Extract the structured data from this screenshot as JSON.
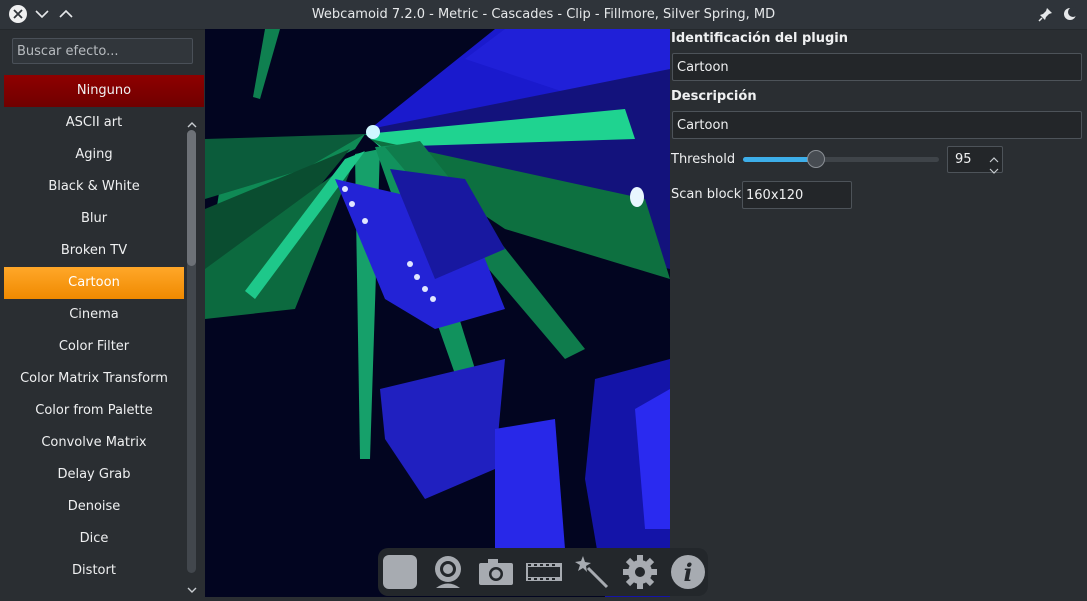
{
  "window": {
    "title": "Webcamoid 7.2.0 - Metric - Cascades - Clip - Fillmore, Silver Spring, MD",
    "close_icon": "close-icon",
    "minimize_icon": "chevron-down-icon",
    "maximize_icon": "chevron-up-icon",
    "pin_icon": "pin-icon",
    "theme_icon": "moon-icon"
  },
  "effects": {
    "search_placeholder": "Buscar efecto...",
    "none_label": "Ninguno",
    "selected": "Cartoon",
    "items": [
      "ASCII art",
      "Aging",
      "Black & White",
      "Blur",
      "Broken TV",
      "Cartoon",
      "Cinema",
      "Color Filter",
      "Color Matrix Transform",
      "Color from Palette",
      "Convolve Matrix",
      "Delay Grab",
      "Denoise",
      "Dice",
      "Distort"
    ]
  },
  "toolbar": {
    "items": [
      "stop-icon",
      "webcam-icon",
      "camera-icon",
      "film-icon",
      "magic-wand-icon",
      "gear-icon",
      "info-icon"
    ]
  },
  "plugin": {
    "id_label": "Identificación del plugin",
    "id_value": "Cartoon",
    "desc_label": "Descripción",
    "desc_value": "Cartoon",
    "threshold_label": "Threshold",
    "threshold_value": "95",
    "threshold_fraction": 0.37,
    "scan_block_label": "Scan block",
    "scan_block_value": "160x120"
  },
  "colors": {
    "selected_bg": "#f39b1c",
    "none_bg": "#7e0000",
    "accent": "#3daee9"
  }
}
